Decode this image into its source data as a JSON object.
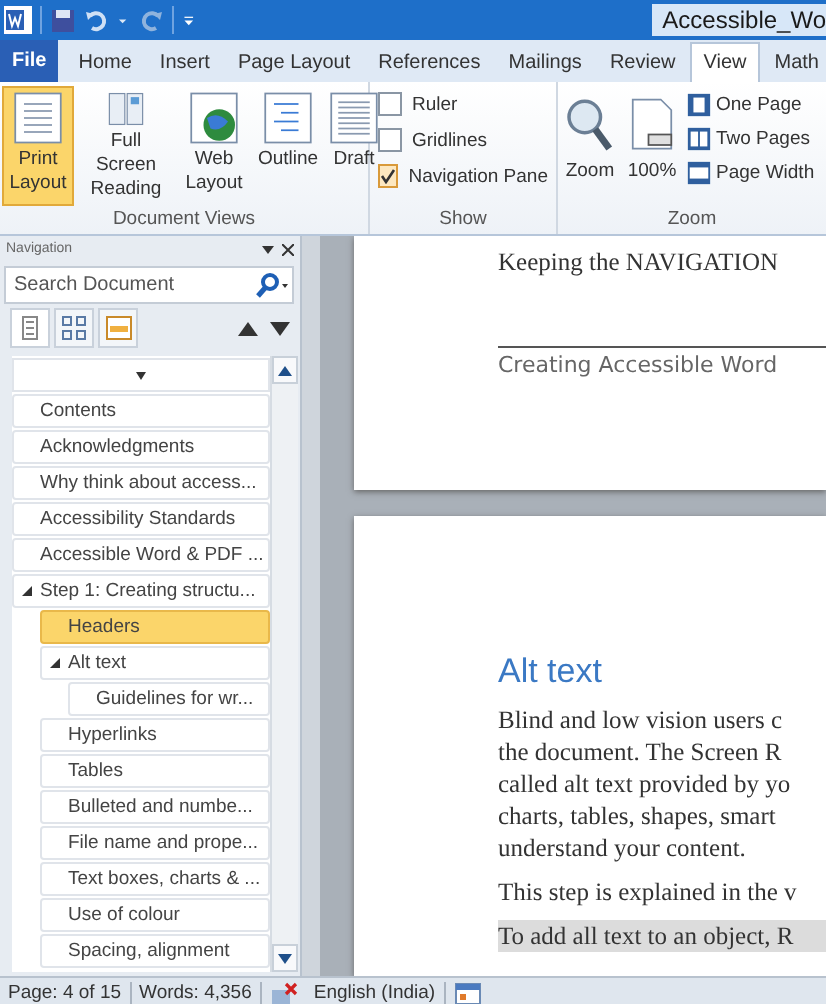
{
  "title_bar": {
    "title": "Accessible_Wo"
  },
  "tabs": [
    {
      "label": "File",
      "kind": "file"
    },
    {
      "label": "Home",
      "kind": "tab",
      "selected": false
    },
    {
      "label": "Insert",
      "kind": "tab",
      "selected": false
    },
    {
      "label": "Page Layout",
      "kind": "tab",
      "selected": false
    },
    {
      "label": "References",
      "kind": "tab",
      "selected": false
    },
    {
      "label": "Mailings",
      "kind": "tab",
      "selected": false
    },
    {
      "label": "Review",
      "kind": "tab",
      "selected": false
    },
    {
      "label": "View",
      "kind": "tab",
      "selected": true
    },
    {
      "label": "Math",
      "kind": "tab",
      "selected": false
    }
  ],
  "ribbon": {
    "document_views": {
      "label": "Document Views",
      "buttons": [
        {
          "label": "Print Layout",
          "kind": "print",
          "selected": true
        },
        {
          "label": "Full Screen Reading",
          "kind": "fullscreen",
          "selected": false
        },
        {
          "label": "Web Layout",
          "kind": "web",
          "selected": false
        },
        {
          "label": "Outline",
          "kind": "outline",
          "selected": false
        },
        {
          "label": "Draft",
          "kind": "draft",
          "selected": false
        }
      ]
    },
    "show": {
      "label": "Show",
      "checkboxes": [
        {
          "label": "Ruler",
          "checked": false
        },
        {
          "label": "Gridlines",
          "checked": false
        },
        {
          "label": "Navigation Pane",
          "checked": true
        }
      ]
    },
    "zoom": {
      "label": "Zoom",
      "buttons": [
        {
          "label": "Zoom",
          "kind": "zoom"
        },
        {
          "label": "100%",
          "kind": "hundred"
        }
      ],
      "small_buttons": [
        {
          "label": "One Page",
          "kind": "one"
        },
        {
          "label": "Two Pages",
          "kind": "two"
        },
        {
          "label": "Page Width",
          "kind": "width"
        }
      ]
    }
  },
  "navigation": {
    "title": "Navigation",
    "search": {
      "placeholder": "Search Document"
    },
    "headings": [
      {
        "label": "Contents",
        "selected": false
      },
      {
        "label": "Acknowledgments",
        "selected": false
      },
      {
        "label": "Why think about access...",
        "selected": false
      },
      {
        "label": "Accessibility Standards",
        "selected": false
      },
      {
        "label": "Accessible Word & PDF ...",
        "selected": false
      },
      {
        "label": "Step 1: Creating structu...",
        "selected": false,
        "expanded": true,
        "children": [
          {
            "label": "Headers",
            "selected": true
          },
          {
            "label": "Alt text",
            "selected": false,
            "expanded": true,
            "children": [
              {
                "label": "Guidelines for wr...",
                "selected": false
              }
            ]
          },
          {
            "label": "Hyperlinks",
            "selected": false
          },
          {
            "label": "Tables",
            "selected": false
          },
          {
            "label": "Bulleted and numbe...",
            "selected": false
          },
          {
            "label": "File name and prope...",
            "selected": false
          },
          {
            "label": "Text boxes, charts & ...",
            "selected": false
          },
          {
            "label": "Use of colour",
            "selected": false
          },
          {
            "label": "Spacing, alignment",
            "selected": false
          }
        ]
      }
    ]
  },
  "document": {
    "page_1": {
      "header": "Keeping the NAVIGATION",
      "footer": "Creating Accessible Word"
    },
    "page_2": {
      "heading": "Alt text",
      "paragraph_lines": [
        "Blind and low vision users c",
        "the document. The Screen R",
        "called alt text provided by yo",
        "charts, tables, shapes, smart",
        "understand your content."
      ],
      "line": "This step is explained in the v",
      "highlighted_line": "To add all text to an object, R"
    }
  },
  "status_bar": {
    "page": "Page: 4 of 15",
    "words": "Words: 4,356",
    "language": "English (India)"
  }
}
